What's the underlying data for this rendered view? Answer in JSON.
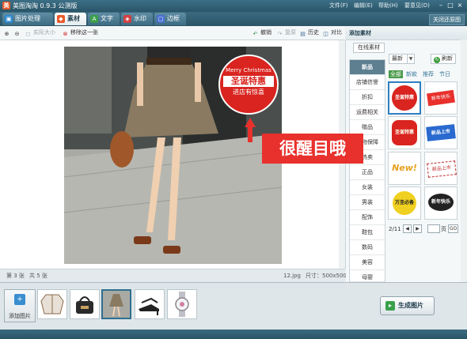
{
  "app": {
    "title": "美图淘淘 0.9.3 公测版",
    "menu": {
      "file": "文件(F)",
      "edit": "编辑(E)",
      "help": "帮助(H)",
      "feedback": "要意见(D)"
    }
  },
  "tabs": [
    {
      "label": "图片处理",
      "icon": "image-process-icon"
    },
    {
      "label": "素材",
      "icon": "material-icon"
    },
    {
      "label": "文字",
      "icon": "text-icon"
    },
    {
      "label": "水印",
      "icon": "watermark-icon"
    },
    {
      "label": "边框",
      "icon": "frame-icon"
    }
  ],
  "close_all_button": "关闭还原图",
  "toolbar": {
    "actual_size": "实际大小",
    "remove_one": "移除这一张",
    "undo": "撤销",
    "reset": "复原",
    "history": "历史",
    "compare": "对比"
  },
  "canvas": {
    "overlay_text": "很醒目哦",
    "badge_line1": "Merry Christmas",
    "badge_line2": "圣诞特惠",
    "badge_line3": "进店有惊喜"
  },
  "status": {
    "current": "第 3 张",
    "total": "共 5 张",
    "filename": "12.jpg",
    "size": "尺寸：500x500"
  },
  "right_panel": {
    "title": "添加素材",
    "subtab": "在线素材",
    "categories": [
      "新品",
      "店铺信誉",
      "折扣",
      "运费相关",
      "赠品",
      "购物保障",
      "热卖",
      "正品",
      "女装",
      "男装",
      "配饰",
      "鞋包",
      "数码",
      "美容",
      "母婴",
      "箱包",
      "家居"
    ],
    "sort": "最新",
    "refresh": "刷新",
    "filters": [
      "全部",
      "新款",
      "推荐",
      "节日"
    ],
    "pager": {
      "page": "2/11",
      "page_suffix": "页",
      "go": "GO"
    },
    "stickers": [
      "圣诞特惠",
      "新年快乐",
      "圣诞特惠",
      "新品上市",
      "New!",
      "新品上市",
      "万圣必备",
      "新年快乐"
    ]
  },
  "bottom": {
    "add_image": "添加图片",
    "generate": "生成图片",
    "thumbnails": [
      "blouse",
      "handbag",
      "skirt",
      "heels",
      "watch"
    ]
  },
  "colors": {
    "accent_blue": "#2f6f8f",
    "overlay_red": "#e8302c",
    "badge_red": "#d9241f"
  }
}
